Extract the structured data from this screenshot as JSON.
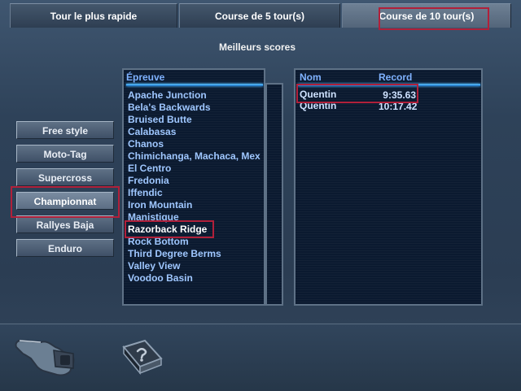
{
  "tabs": [
    {
      "label": "Tour le plus rapide"
    },
    {
      "label": "Course de 5 tour(s)"
    },
    {
      "label": "Course de 10 tour(s)"
    }
  ],
  "title": "Meilleurs scores",
  "modes": [
    {
      "label": "Free style"
    },
    {
      "label": "Moto-Tag"
    },
    {
      "label": "Supercross"
    },
    {
      "label": "Championnat"
    },
    {
      "label": "Rallyes Baja"
    },
    {
      "label": "Enduro"
    }
  ],
  "tracks_header": "Épreuve",
  "tracks": [
    "Apache Junction",
    "Bela's Backwards",
    "Bruised Butte",
    "Calabasas",
    "Chanos",
    "Chimichanga, Machaca, Mex",
    "El Centro",
    "Fredonia",
    "Iffendic",
    "Iron Mountain",
    "Manistique",
    "Razorback Ridge",
    "Rock Bottom",
    "Third Degree Berms",
    "Valley View",
    "Voodoo Basin"
  ],
  "selected_track": "Razorback Ridge",
  "scores": {
    "headers": {
      "name": "Nom",
      "record": "Record"
    },
    "rows": [
      {
        "name": "Quentin",
        "record": "9:35.63"
      },
      {
        "name": "Quentin",
        "record": "10:17.42"
      }
    ]
  },
  "icons": {
    "back": "pointing-hand-icon",
    "help": "help-book-icon"
  }
}
